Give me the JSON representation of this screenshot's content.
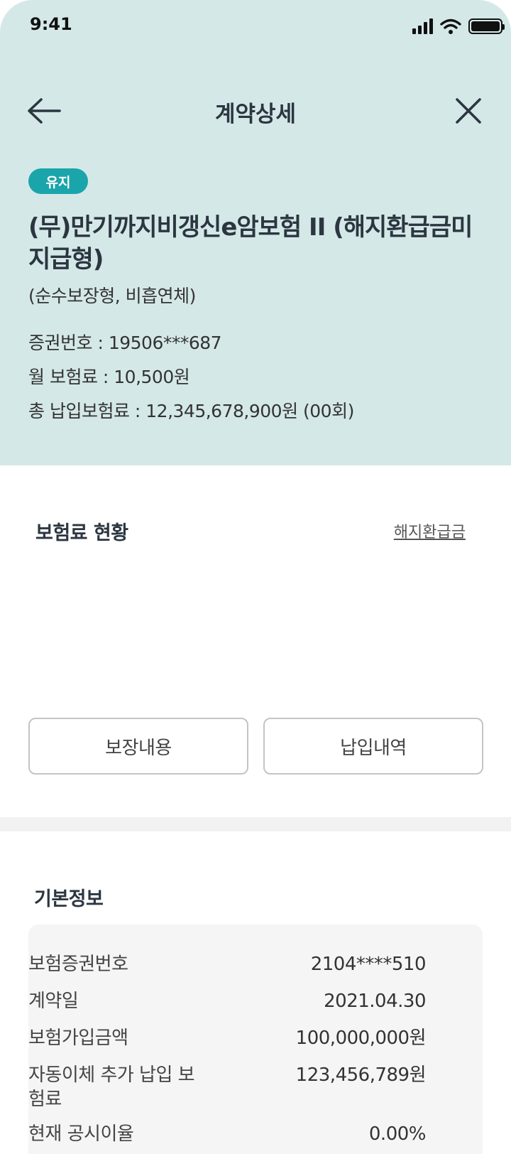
{
  "status_bar": {
    "time": "9:41"
  },
  "nav": {
    "title": "계약상세"
  },
  "contract": {
    "status_badge": "유지",
    "product_name": "(무)만기까지비갱신e암보험 II (해지환급금미지급형)",
    "product_subtitle": "(순수보장형, 비흡연체)",
    "policy_number_line": "증권번호 : 19506***687",
    "monthly_premium_line": "월 보험료 : 10,500원",
    "total_paid_line": "총 납입보험료 : 12,345,678,900원 (00회)"
  },
  "premium_section": {
    "title": "보험료 현황",
    "refund_link": "해지환급금"
  },
  "buttons": {
    "coverage": "보장내용",
    "payment_history": "납입내역"
  },
  "basic_info": {
    "title": "기본정보",
    "rows": [
      {
        "label": "보험증권번호",
        "value": "2104****510"
      },
      {
        "label": "계약일",
        "value": "2021.04.30"
      },
      {
        "label": "보험가입금액",
        "value": "100,000,000원"
      },
      {
        "label": "자동이체 추가 납입 보험료",
        "value": "123,456,789원"
      },
      {
        "label": "현재 공시이율",
        "value": "0.00%"
      }
    ]
  },
  "colors": {
    "hero_background": "#d5e8e8",
    "badge": "#1aa5ab",
    "title_text": "#2b3640"
  }
}
